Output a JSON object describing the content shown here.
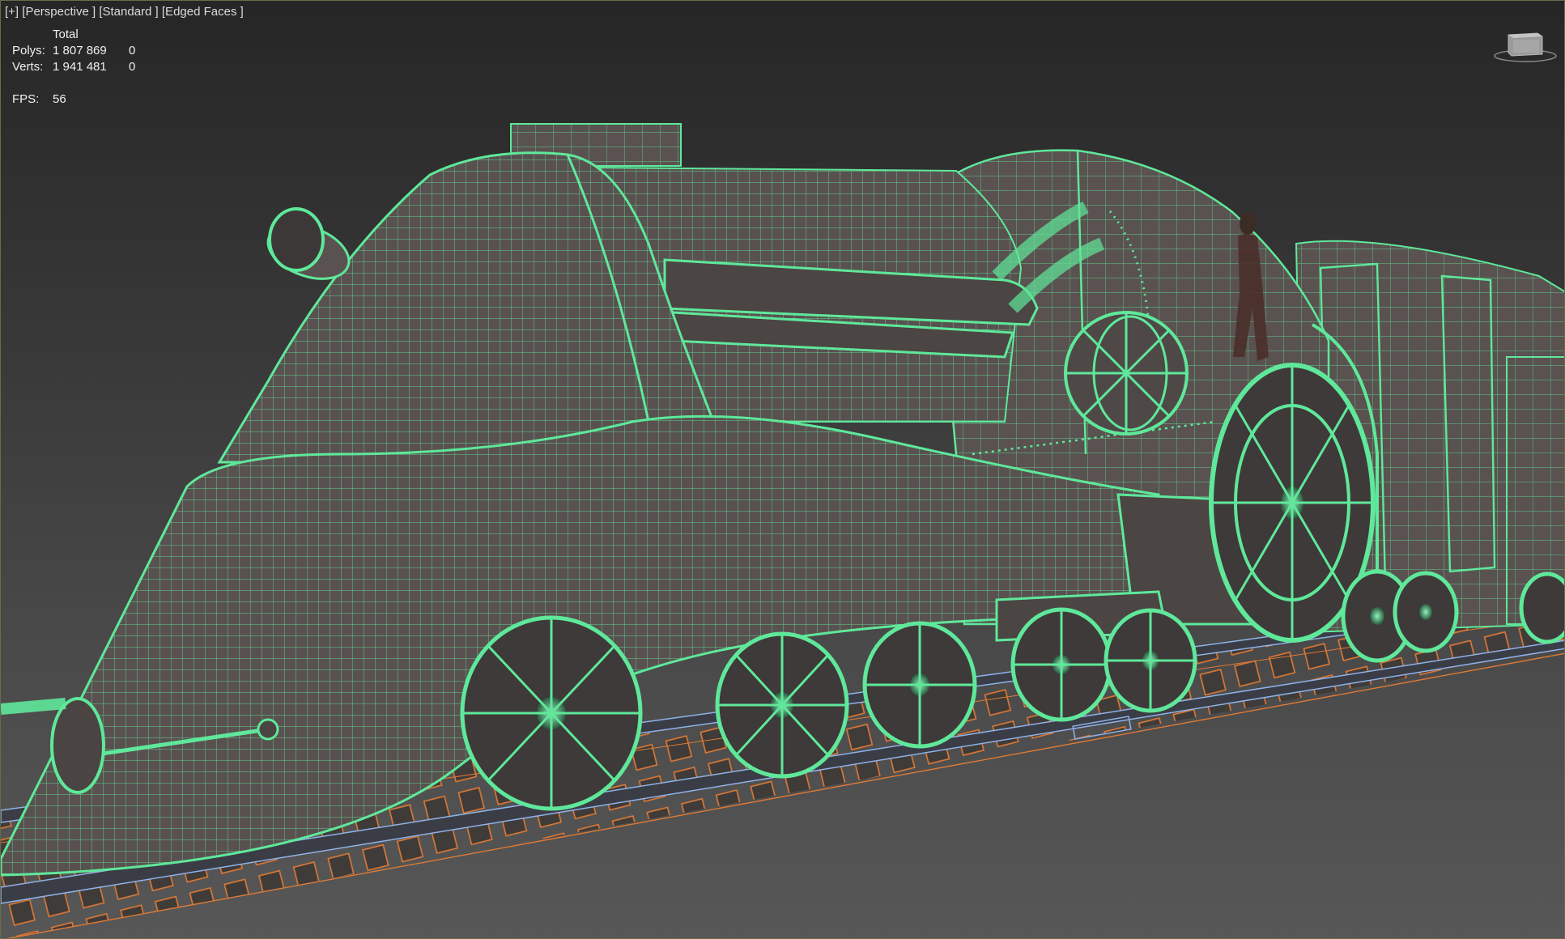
{
  "viewport": {
    "labels": [
      {
        "id": "plus",
        "text": "[+]"
      },
      {
        "id": "view",
        "text": "[Perspective ]"
      },
      {
        "id": "shading",
        "text": "[Standard ]"
      },
      {
        "id": "display",
        "text": "[Edged Faces ]"
      }
    ]
  },
  "stats": {
    "header": "Total",
    "polys_label": "Polys:",
    "polys_total": "1 807 869",
    "polys_selected": "0",
    "verts_label": "Verts:",
    "verts_total": "1 941 481",
    "verts_selected": "0",
    "fps_label": "FPS:",
    "fps_value": "56"
  },
  "viewcube": {
    "icon": "viewcube-icon"
  },
  "colors": {
    "wireframe": "#5fe89a",
    "body_fill": "#5b5452",
    "rail_orange": "#e07a35",
    "rail_blue": "#8fb2e8",
    "background": "#3a3a3a"
  }
}
